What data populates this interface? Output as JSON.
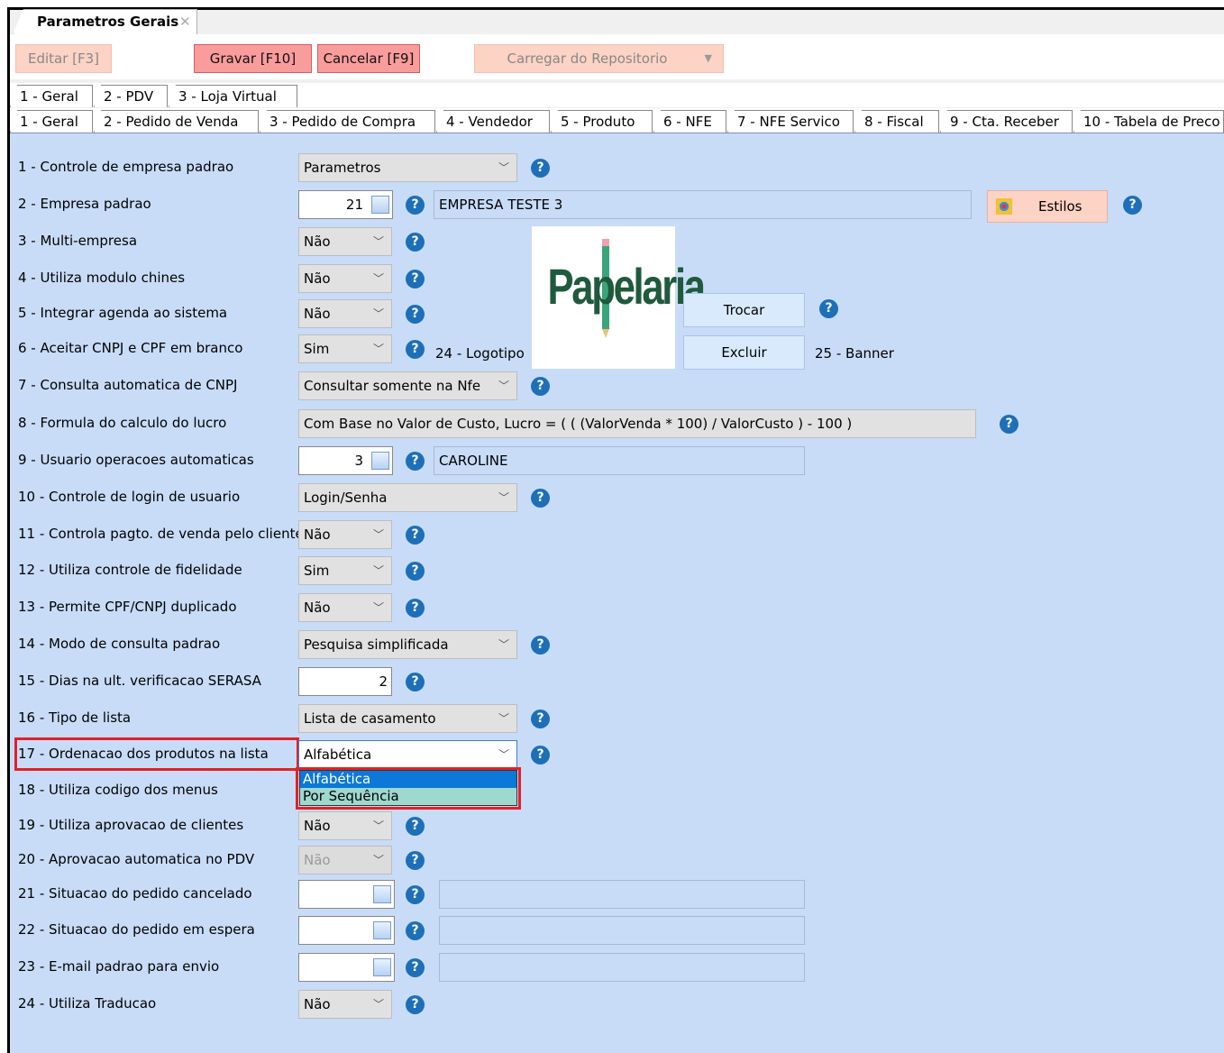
{
  "window": {
    "tab_title": "Parametros Gerais"
  },
  "toolbar": {
    "edit": "Editar [F3]",
    "save": "Gravar [F10]",
    "cancel": "Cancelar [F9]",
    "load_repo": "Carregar do Repositorio"
  },
  "tabs_top": [
    "1 - Geral",
    "2 - PDV",
    "3 - Loja Virtual"
  ],
  "tabs_sub": [
    "1 - Geral",
    "2 - Pedido de Venda",
    "3 - Pedido de Compra",
    "4 - Vendedor",
    "5 - Produto",
    "6 - NFE",
    "7 - NFE Servico",
    "8 - Fiscal",
    "9 - Cta. Receber",
    "10 - Tabela de Preco"
  ],
  "params": {
    "p1": {
      "label": "1 - Controle de empresa padrao",
      "value": "Parametros"
    },
    "p2": {
      "label": "2 - Empresa padrao",
      "value": "21",
      "desc": "EMPRESA TESTE 3"
    },
    "p3": {
      "label": "3 - Multi-empresa",
      "value": "Não"
    },
    "p4": {
      "label": "4 - Utiliza modulo chines",
      "value": "Não"
    },
    "p5": {
      "label": "5 - Integrar agenda ao sistema",
      "value": "Não"
    },
    "p6": {
      "label": "6 - Aceitar CNPJ e CPF em branco",
      "value": "Sim"
    },
    "p7": {
      "label": "7 - Consulta automatica de CNPJ",
      "value": "Consultar somente na Nfe"
    },
    "p8": {
      "label": "8 - Formula do calculo do lucro",
      "value": "Com Base no Valor de Custo, Lucro = ( ( (ValorVenda * 100) / ValorCusto ) - 100 )"
    },
    "p9": {
      "label": "9 - Usuario operacoes automaticas",
      "value": "3",
      "desc": "CAROLINE"
    },
    "p10": {
      "label": "10 - Controle de login de usuario",
      "value": "Login/Senha"
    },
    "p11": {
      "label": "11 - Controla pagto. de venda pelo cliente",
      "value": "Não"
    },
    "p12": {
      "label": "12 - Utiliza controle de fidelidade",
      "value": "Sim"
    },
    "p13": {
      "label": "13 - Permite CPF/CNPJ duplicado",
      "value": "Não"
    },
    "p14": {
      "label": "14 - Modo de consulta padrao",
      "value": "Pesquisa simplificada"
    },
    "p15": {
      "label": "15 - Dias na ult. verificacao SERASA",
      "value": "2"
    },
    "p16": {
      "label": "16 - Tipo de lista",
      "value": "Lista de casamento"
    },
    "p17": {
      "label": "17 - Ordenacao dos produtos na lista",
      "value": "Alfabética",
      "options": [
        "Alfabética",
        "Por Sequência"
      ]
    },
    "p18": {
      "label": "18 - Utiliza codigo dos menus"
    },
    "p19": {
      "label": "19 - Utiliza aprovacao de clientes",
      "value": "Não"
    },
    "p20": {
      "label": "20 - Aprovacao automatica no PDV",
      "value": "Não"
    },
    "p21": {
      "label": "21 - Situacao do pedido cancelado"
    },
    "p22": {
      "label": "22 - Situacao do pedido em espera"
    },
    "p23": {
      "label": "23 - E-mail padrao para envio"
    },
    "p24": {
      "label": "24 - Utiliza Traducao",
      "value": "Não"
    }
  },
  "logo": {
    "label": "24 - Logotipo",
    "banner_label": "25 - Banner",
    "logo_text": "Papelaria",
    "change_button": "Trocar",
    "delete_button": "Excluir"
  },
  "styles_button": "Estilos",
  "help_glyph": "?",
  "colors": {
    "content_bg": "#c8dcf7",
    "button_active": "#fa9c9c",
    "button_disabled": "#fcd3c4",
    "highlight_red": "#e0212b",
    "logo_green": "#1f5a3c"
  }
}
